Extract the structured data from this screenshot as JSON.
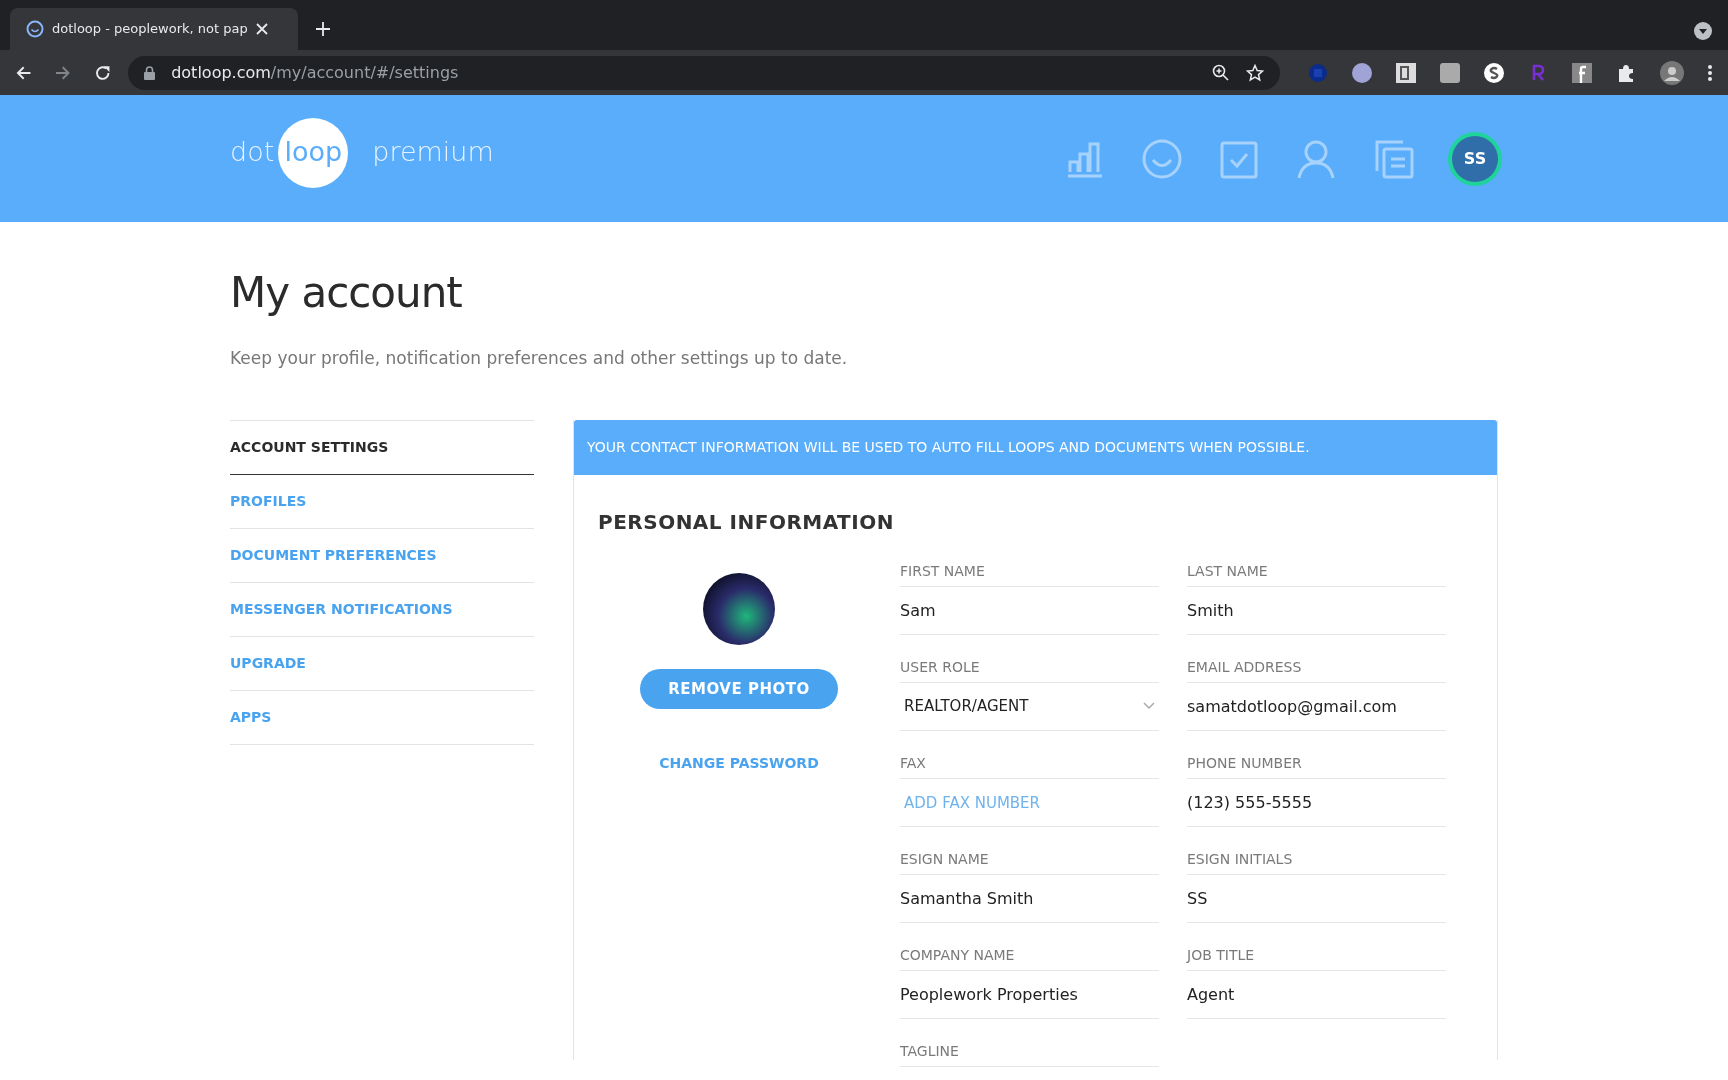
{
  "browser": {
    "tab_title": "dotloop - peoplework, not pap",
    "url_host": "dotloop.com",
    "url_path": "/my/account/#/settings"
  },
  "header": {
    "logo": {
      "left": "dot",
      "circle": "loop",
      "suffix": "premium"
    },
    "avatar": "SS"
  },
  "page": {
    "title": "My account",
    "subtitle": "Keep your profile, notification preferences and other settings up to date."
  },
  "sidebar": {
    "items": [
      {
        "label": "ACCOUNT SETTINGS",
        "selected": true
      },
      {
        "label": "PROFILES",
        "selected": false
      },
      {
        "label": "DOCUMENT PREFERENCES",
        "selected": false
      },
      {
        "label": "MESSENGER NOTIFICATIONS",
        "selected": false
      },
      {
        "label": "UPGRADE",
        "selected": false
      },
      {
        "label": "APPS",
        "selected": false
      }
    ]
  },
  "banner": "YOUR CONTACT INFORMATION WILL BE USED TO AUTO FILL LOOPS AND DOCUMENTS WHEN POSSIBLE.",
  "personal_information": {
    "title": "PERSONAL INFORMATION",
    "remove_photo": "REMOVE PHOTO",
    "change_password": "CHANGE PASSWORD",
    "fields": [
      {
        "label": "FIRST NAME",
        "kind": "text",
        "value": "Sam"
      },
      {
        "label": "LAST NAME",
        "kind": "text",
        "value": "Smith"
      },
      {
        "label": "USER ROLE",
        "kind": "select",
        "value": "REALTOR/AGENT"
      },
      {
        "label": "EMAIL ADDRESS",
        "kind": "text",
        "value": "samatdotloop@gmail.com"
      },
      {
        "label": "FAX",
        "kind": "action",
        "value": "ADD FAX NUMBER"
      },
      {
        "label": "PHONE NUMBER",
        "kind": "text",
        "value": "(123) 555-5555"
      },
      {
        "label": "ESIGN NAME",
        "kind": "text",
        "value": "Samantha Smith"
      },
      {
        "label": "ESIGN INITIALS",
        "kind": "text",
        "value": "SS"
      },
      {
        "label": "COMPANY NAME",
        "kind": "text",
        "value": "Peoplework Properties"
      },
      {
        "label": "JOB TITLE",
        "kind": "text",
        "value": "Agent"
      },
      {
        "label": "TAGLINE",
        "kind": "text"
      }
    ]
  }
}
